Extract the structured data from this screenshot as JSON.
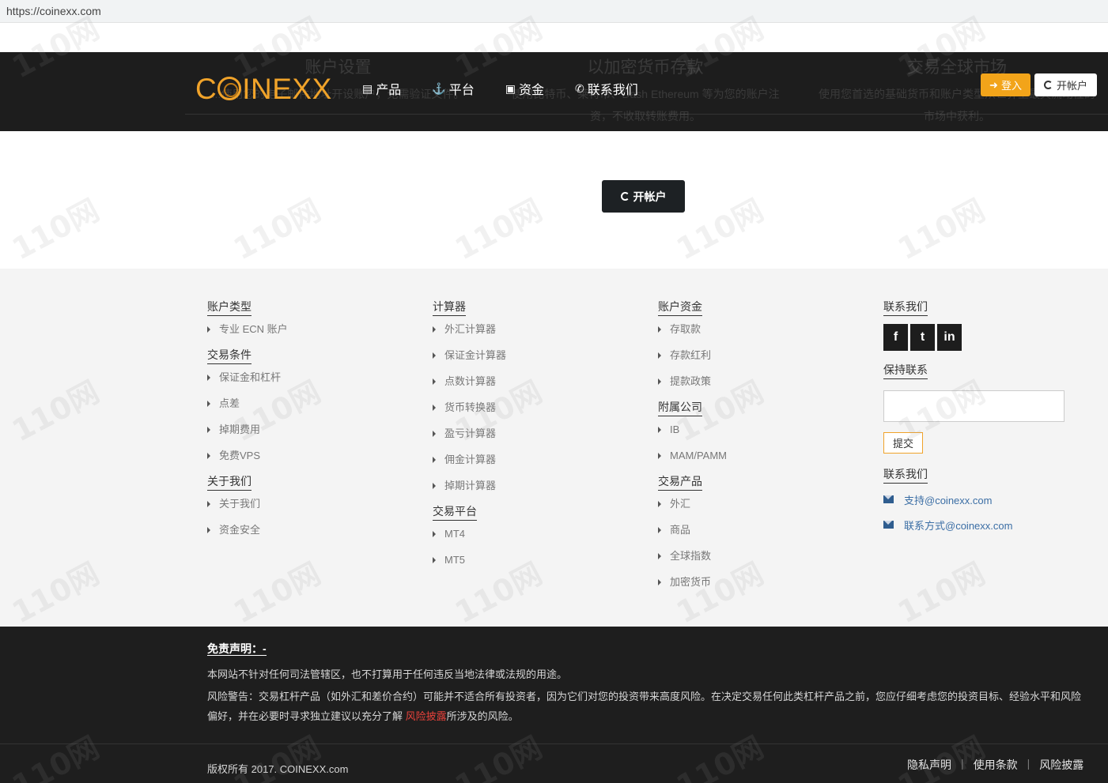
{
  "browser": {
    "url": "https://coinexx.com"
  },
  "ghost_features": [
    {
      "title": "账户设置",
      "desc": "...使用您的电子邮件地址开设账户，无需验证文件。"
    },
    {
      "title": "以加密货币存款",
      "desc": "使用比特币、莱特币、Dash Ethereum 等为您的账户注资，不收取转账费用。"
    },
    {
      "title": "交易全球市场",
      "desc": "使用您首选的基础货币和账户类型从世界上最具流动性的市场中获利。"
    }
  ],
  "header": {
    "logo": "COINEXX",
    "nav": [
      {
        "label": "产品",
        "icon": "inbox-icon"
      },
      {
        "label": "平台",
        "icon": "anchor-icon"
      },
      {
        "label": "资金",
        "icon": "money-icon"
      },
      {
        "label": "联系我们",
        "icon": "phone-icon"
      }
    ],
    "login_label": "登入",
    "open_account_label": "开帐户"
  },
  "cta": {
    "label": "开帐户"
  },
  "footer": {
    "col1": [
      {
        "title": "账户类型",
        "links": [
          "专业 ECN 账户"
        ]
      },
      {
        "title": "交易条件",
        "links": [
          "保证金和杠杆",
          "点差",
          "掉期费用",
          "免费VPS"
        ]
      },
      {
        "title": "关于我们",
        "links": [
          "关于我们",
          "资金安全"
        ]
      }
    ],
    "col2": [
      {
        "title": "计算器",
        "links": [
          "外汇计算器",
          "保证金计算器",
          "点数计算器",
          "货币转换器",
          "盈亏计算器",
          "佣金计算器",
          "掉期计算器"
        ]
      },
      {
        "title": "交易平台",
        "links": [
          "MT4",
          "MT5"
        ]
      }
    ],
    "col3": [
      {
        "title": "账户资金",
        "links": [
          "存取款",
          "存款红利",
          "提款政策"
        ]
      },
      {
        "title": "附属公司",
        "links": [
          "IB",
          "MAM/PAMM"
        ]
      },
      {
        "title": "交易产品",
        "links": [
          "外汇",
          "商品",
          "全球指数",
          "加密货币"
        ]
      }
    ],
    "contact": {
      "title": "联系我们",
      "social": [
        "f",
        "t",
        "in"
      ],
      "keep_title": "保持联系",
      "submit_label": "提交",
      "contact_title": "联系我们",
      "emails": [
        "支持@coinexx.com",
        "联系方式@coinexx.com"
      ]
    },
    "disclaimer": {
      "title": "免责声明：-",
      "p1": "本网站不针对任何司法管辖区，也不打算用于任何违反当地法律或法规的用途。",
      "p2_before": "风险警告：交易杠杆产品（如外汇和差价合约）可能并不适合所有投资者，因为它们对您的投资带来高度风险。在决定交易任何此类杠杆产品之前，您应仔细考虑您的投资目标、经验水平和风险偏好，并在必要时寻求独立建议以充分了解 ",
      "p2_link": "风险披露",
      "p2_after": "所涉及的风险。"
    },
    "copyright": "版权所有 2017. COINEXX.com",
    "legal": [
      "隐私声明",
      "使用条款",
      "风险披露"
    ]
  },
  "watermark": "110网"
}
